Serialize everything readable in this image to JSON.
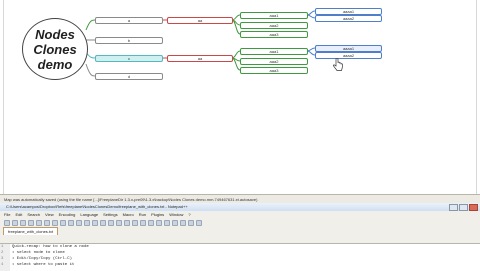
{
  "mindmap": {
    "root_lines": [
      "Nodes",
      "Clones",
      "demo"
    ],
    "nodes_level1": [
      "a",
      "b",
      "c",
      "d"
    ],
    "node_aa": [
      "aa",
      "aa"
    ],
    "node_aaa": [
      "aaa1",
      "aaa2",
      "aaa3",
      "aaa1",
      "aaa2",
      "aaa3"
    ],
    "node_aaaa": [
      "aaaa1",
      "aaaa2",
      "aaaa1",
      "aaaa2"
    ]
  },
  "status_bar": {
    "text": "Map was automatically saved (using the file name [...]\\FreeplaneDir 1.3.x-pre09\\1.3.x\\backup\\Nodes Clones demo.mm.749467631.xt.autosave)"
  },
  "editor_window": {
    "title": "C:\\Users\\acampos\\Dropbox\\Refs\\freeplane\\NodesClonesDemo\\freeplane_with_clones.txt - Notepad++",
    "menu": [
      "File",
      "Edit",
      "Search",
      "View",
      "Encoding",
      "Language",
      "Settings",
      "Macro",
      "Run",
      "Plugins",
      "Window",
      "?"
    ],
    "tab": "freeplane_with_clones.txt",
    "lines": [
      {
        "num": "1",
        "text": "Quick-recap: how to clone a node"
      },
      {
        "num": "2",
        "text": "  • select node to clone"
      },
      {
        "num": "3",
        "text": "  • Edit/Copy/Copy  (Ctrl-C)"
      },
      {
        "num": "4",
        "text": "  • select where to paste it"
      }
    ]
  }
}
